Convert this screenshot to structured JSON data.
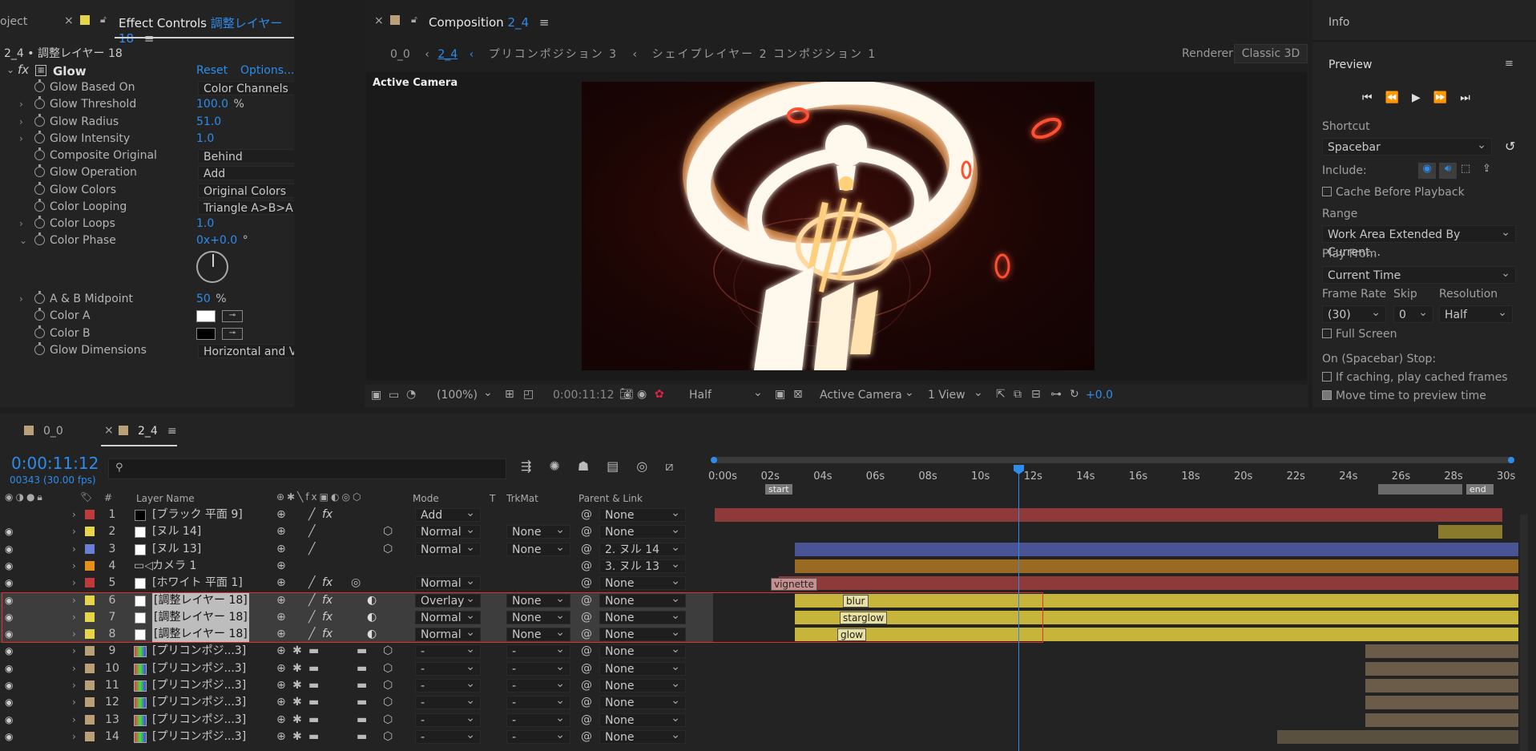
{
  "effect_panel": {
    "left_tab": "oject",
    "title": "Effect Controls",
    "title_layer": "調整レイヤー 18",
    "subtitle": "2_4 • 調整レイヤー 18",
    "effect_name": "Glow",
    "reset": "Reset",
    "options": "Options...",
    "props": [
      {
        "label": "Glow Based On",
        "dropdown": "Color Channels"
      },
      {
        "label": "Glow Threshold",
        "value": "100.0",
        "unit": "%"
      },
      {
        "label": "Glow Radius",
        "value": "51.0"
      },
      {
        "label": "Glow Intensity",
        "value": "1.0"
      },
      {
        "label": "Composite Original",
        "dropdown": "Behind"
      },
      {
        "label": "Glow Operation",
        "dropdown": "Add"
      },
      {
        "label": "Glow Colors",
        "dropdown": "Original Colors"
      },
      {
        "label": "Color Looping",
        "dropdown": "Triangle A>B>A"
      },
      {
        "label": "Color Loops",
        "value": "1.0"
      },
      {
        "label": "Color Phase",
        "value": "0x+0.0",
        "unit": "°"
      },
      {
        "label": "A & B Midpoint",
        "value": "50",
        "unit": "%"
      },
      {
        "label": "Color A"
      },
      {
        "label": "Color B"
      },
      {
        "label": "Glow Dimensions",
        "dropdown": "Horizontal and Vertical"
      }
    ]
  },
  "comp_panel": {
    "title": "Composition",
    "comp_name": "2_4",
    "nav": [
      "0_0",
      "2_4",
      "プリコンポジション 3",
      "シェイプレイヤー 2 コンポジション 1"
    ],
    "renderer_label": "Renderer:",
    "renderer_value": "Classic 3D",
    "active_camera": "Active Camera",
    "zoom": "(100%)",
    "timecode": "0:00:11:12",
    "resolution": "Half",
    "camera": "Active Camera",
    "views": "1 View",
    "exposure": "+0.0"
  },
  "right_panel": {
    "info": "Info",
    "preview": "Preview",
    "shortcut_label": "Shortcut",
    "shortcut_value": "Spacebar",
    "include_label": "Include:",
    "cache_before": "Cache Before Playback",
    "range_label": "Range",
    "range_value": "Work Area Extended By Current...",
    "play_from_label": "Play From",
    "play_from_value": "Current Time",
    "frame_rate_label": "Frame Rate",
    "skip_label": "Skip",
    "resolution_label": "Resolution",
    "frame_rate_value": "(30)",
    "skip_value": "0",
    "resolution_value": "Half",
    "full_screen": "Full Screen",
    "stop_label": "On (Spacebar) Stop:",
    "if_caching": "If caching, play cached frames",
    "move_time": "Move time to preview time"
  },
  "timeline": {
    "tabs": [
      "0_0",
      "2_4"
    ],
    "timecode": "0:00:11:12",
    "frames": "00343 (30.00 fps)",
    "search_placeholder": "",
    "col_layer_name": "Layer Name",
    "col_mode": "Mode",
    "col_t": "T",
    "col_trkmat": "TrkMat",
    "col_parent": "Parent & Link",
    "ruler": [
      "0:00s",
      "02s",
      "04s",
      "06s",
      "08s",
      "10s",
      "12s",
      "14s",
      "16s",
      "18s",
      "20s",
      "22s",
      "24s",
      "26s",
      "28s",
      "30s"
    ],
    "current_time_fraction": 0.418,
    "layers": [
      {
        "num": "1",
        "name": "[ブラック 平面 9]",
        "mode": "Add",
        "trkmat": "",
        "parent": "None",
        "label": "#c0393b",
        "fx": true
      },
      {
        "num": "2",
        "name": "[ヌル 14]",
        "mode": "Normal",
        "trkmat": "None",
        "parent": "None",
        "label": "#e6d44a",
        "fx": false
      },
      {
        "num": "3",
        "name": "[ヌル 13]",
        "mode": "Normal",
        "trkmat": "None",
        "parent": "2. ヌル 14",
        "label": "#6b7fd6",
        "fx": false
      },
      {
        "num": "4",
        "name": "カメラ 1",
        "mode": "",
        "trkmat": "",
        "parent": "3. ヌル 13",
        "label": "#e6901a",
        "fx": false
      },
      {
        "num": "5",
        "name": "[ホワイト 平面 1]",
        "mode": "Normal",
        "trkmat": "",
        "parent": "None",
        "label": "#c0393b",
        "fx": true
      },
      {
        "num": "6",
        "name": "[調整レイヤー 18]",
        "mode": "Overlay",
        "trkmat": "None",
        "parent": "None",
        "label": "#e6d44a",
        "fx": true
      },
      {
        "num": "7",
        "name": "[調整レイヤー 18]",
        "mode": "Normal",
        "trkmat": "None",
        "parent": "None",
        "label": "#e6d44a",
        "fx": true
      },
      {
        "num": "8",
        "name": "[調整レイヤー 18]",
        "mode": "Normal",
        "trkmat": "None",
        "parent": "None",
        "label": "#e6d44a",
        "fx": true
      },
      {
        "num": "9",
        "name": "[プリコンポジ...3]",
        "mode": "-",
        "trkmat": "-",
        "parent": "None",
        "label": "#b9a078",
        "fx": false
      },
      {
        "num": "10",
        "name": "[プリコンポジ...3]",
        "mode": "-",
        "trkmat": "-",
        "parent": "None",
        "label": "#b9a078",
        "fx": false
      },
      {
        "num": "11",
        "name": "[プリコンポジ...3]",
        "mode": "-",
        "trkmat": "-",
        "parent": "None",
        "label": "#b9a078",
        "fx": false
      },
      {
        "num": "12",
        "name": "[プリコンポジ...3]",
        "mode": "-",
        "trkmat": "-",
        "parent": "None",
        "label": "#b9a078",
        "fx": false
      },
      {
        "num": "13",
        "name": "[プリコンポジ...3]",
        "mode": "-",
        "trkmat": "-",
        "parent": "None",
        "label": "#b9a078",
        "fx": false
      },
      {
        "num": "14",
        "name": "[プリコンポジ...3]",
        "mode": "-",
        "trkmat": "-",
        "parent": "None",
        "label": "#b9a078",
        "fx": false
      }
    ],
    "markers": {
      "start": "start",
      "end": "end",
      "vignette": "vignette",
      "blur": "blur",
      "starglow": "starglow",
      "glow": "glow"
    }
  }
}
